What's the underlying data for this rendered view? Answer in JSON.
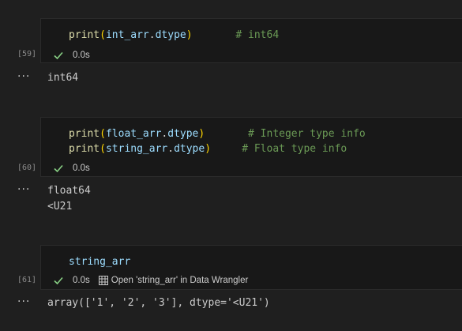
{
  "cells": [
    {
      "exec_count": "[59]",
      "code": [
        {
          "fn": "print",
          "open": "(",
          "obj": "int_arr",
          "dot": ".",
          "attr": "dtype",
          "close": ")",
          "comment": "# int64"
        }
      ],
      "status": {
        "time": "0.0s"
      },
      "output": [
        "int64"
      ]
    },
    {
      "exec_count": "[60]",
      "code": [
        {
          "fn": "print",
          "open": "(",
          "obj": "float_arr",
          "dot": ".",
          "attr": "dtype",
          "close": ")",
          "comment": "# Integer type info"
        },
        {
          "fn": "print",
          "open": "(",
          "obj": "string_arr",
          "dot": ".",
          "attr": "dtype",
          "close": ")",
          "comment": "# Float type info"
        }
      ],
      "status": {
        "time": "0.0s"
      },
      "output": [
        "float64",
        "<U21"
      ]
    },
    {
      "exec_count": "[61]",
      "code_plain": "string_arr",
      "status": {
        "time": "0.0s",
        "action": "Open 'string_arr' in Data Wrangler"
      },
      "output": [
        "array(['1', '2', '3'], dtype='<U21')"
      ]
    }
  ],
  "icons": {
    "success": "check-icon",
    "data_wrangler": "grid-icon",
    "output_menu": "more-icon"
  },
  "colors": {
    "success": "#89d185",
    "function": "#dcdcaa",
    "bracket": "#ffd700",
    "variable": "#9cdcfe",
    "comment": "#6a9955"
  }
}
